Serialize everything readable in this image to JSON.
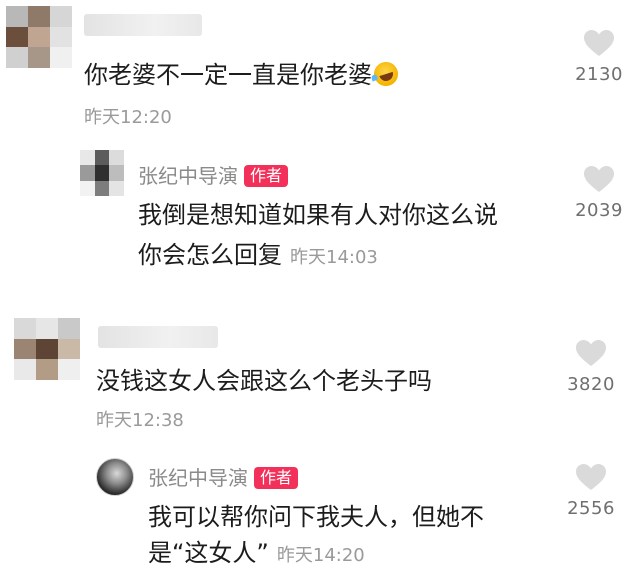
{
  "comments": [
    {
      "text": "你老婆不一定一直是你老婆",
      "time": "昨天12:20",
      "likes": "2130",
      "emoji_icon": "laughing-tears-emoji-icon",
      "avatar_colors": [
        "#b8b8b8",
        "#8f7a6a",
        "#d6d6d6",
        "#6b4f3c",
        "#c0a692",
        "#e2e2e2",
        "#d0d0d0",
        "#a69788",
        "#f0f0f0"
      ],
      "reply": {
        "author": "张纪中导演",
        "badge": "作者",
        "text_line1": "我倒是想知道如果有人对你这么说",
        "text_line2": "你会怎么回复",
        "time": "昨天14:03",
        "likes": "2039",
        "avatar_colors": [
          "#e8e8e8",
          "#5c5c5c",
          "#dcdcdc",
          "#9a9a9a",
          "#2f2f2f",
          "#bdbdbd",
          "#f2f2f2",
          "#7d7d7d",
          "#e4e4e4"
        ]
      }
    },
    {
      "text": "没钱这女人会跟这么个老头子吗",
      "time": "昨天12:38",
      "likes": "3820",
      "avatar_colors": [
        "#d9d9d9",
        "#e6e6e6",
        "#c9c9c9",
        "#9b8572",
        "#5e4434",
        "#cbb9a8",
        "#e9e9e9",
        "#b29c86",
        "#efefef"
      ],
      "reply": {
        "author": "张纪中导演",
        "badge": "作者",
        "text_line1": "我可以帮你问下我夫人，但她不",
        "text_line2": "是“这女人”",
        "time": "昨天14:20",
        "likes": "2556"
      }
    }
  ],
  "icons": {
    "like": "heart-outline-icon"
  },
  "colors": {
    "badge": "#f2305a",
    "heart": "#d4d4d4",
    "meta_text": "#9a9a9a"
  }
}
